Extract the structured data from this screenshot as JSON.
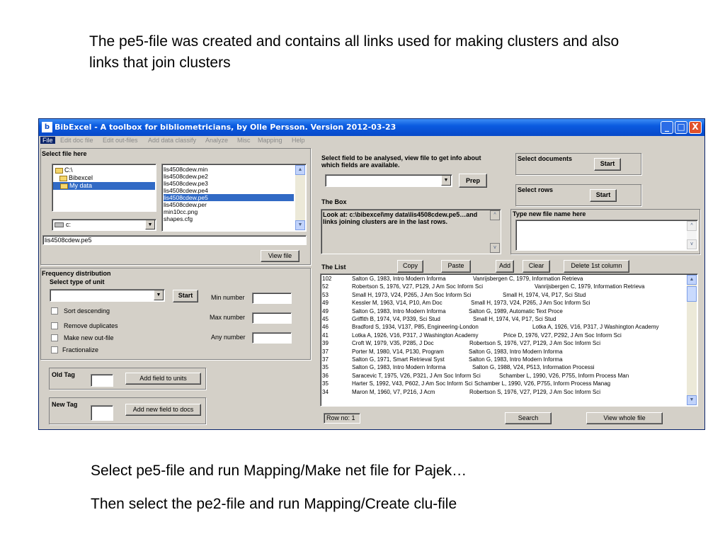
{
  "slide": {
    "intro": "The pe5-file was created and contains all links used for making clusters and also links that join clusters",
    "step1": "Select pe5-file and run Mapping/Make net file for Pajek…",
    "step2": "Then select the pe2-file and run Mapping/Create clu-file"
  },
  "window": {
    "title": "BibExcel -  A toolbox for bibliometricians, by Olle Persson. Version 2012-03-23",
    "icon_letter": "b",
    "minimize": "_",
    "maximize": "□",
    "close": "X"
  },
  "menu": [
    "File",
    "Edit doc file",
    "Edit out-files",
    "Add data classify",
    "Analyze",
    "Misc",
    "Mapping",
    "Help"
  ],
  "select_file": {
    "heading": "Select file here",
    "folders": [
      {
        "label": "C:\\",
        "selected": false
      },
      {
        "label": "Bibexcel",
        "selected": false
      },
      {
        "label": "My data",
        "selected": true
      }
    ],
    "files": [
      {
        "label": "lis4508cdew.min",
        "selected": false
      },
      {
        "label": "lis4508cdew.pe2",
        "selected": false
      },
      {
        "label": "lis4508cdew.pe3",
        "selected": false
      },
      {
        "label": "lis4508cdew.pe4",
        "selected": false
      },
      {
        "label": "lis4508cdew.pe5",
        "selected": true
      },
      {
        "label": "lis4508cdew.per",
        "selected": false
      },
      {
        "label": "min10cc.png",
        "selected": false
      },
      {
        "label": "shapes.cfg",
        "selected": false
      }
    ],
    "drive": "c:",
    "path_value": "lis4508cdew.pe5",
    "view_file": "View file"
  },
  "frequency": {
    "heading": "Frequency distribution",
    "unit_label": "Select type of unit",
    "start": "Start",
    "min_number": "Min number",
    "max_number": "Max number",
    "any_number": "Any number",
    "options": [
      "Sort descending",
      "Remove duplicates",
      "Make new out-file",
      "Fractionalize"
    ]
  },
  "old_tag": {
    "label": "Old Tag",
    "button": "Add field to units"
  },
  "new_tag": {
    "label": "New Tag",
    "button": "Add new field to docs"
  },
  "analyse": {
    "text": "Select field to be analysed, view file to get info about which fields are available.",
    "prep": "Prep"
  },
  "documents": {
    "label": "Select documents",
    "start": "Start"
  },
  "rows": {
    "label": "Select rows",
    "start": "Start"
  },
  "the_box": {
    "title": "The Box",
    "text": "Look at: c:\\bibexcel\\my data\\lis4508cdew.pe5…and links joining clusters are in the last rows."
  },
  "new_file": {
    "label": "Type new file name here"
  },
  "the_list": {
    "title": "The List",
    "buttons": {
      "copy": "Copy",
      "paste": "Paste",
      "add": "Add",
      "clear": "Clear",
      "delete": "Delete 1st column"
    },
    "rows": [
      {
        "count": "102",
        "a": "Salton G, 1983, Intro Modern Informa",
        "b": "Vanrijsbergen C, 1979, Information Retrieva"
      },
      {
        "count": "52",
        "a": "Robertson S, 1976, V27, P129, J Am Soc Inform Sci",
        "b": "Vanrijsbergen C, 1979, Information Retrieva"
      },
      {
        "count": "53",
        "a": "Small H, 1973, V24, P265, J Am Soc Inform Sci",
        "b": "Small H, 1974, V4, P17, Sci Stud"
      },
      {
        "count": "49",
        "a": "Kessler M, 1963, V14, P10, Am Doc",
        "b": "Small H, 1973, V24, P265, J Am Soc Inform Sci"
      },
      {
        "count": "49",
        "a": "Salton G, 1983, Intro Modern Informa",
        "b": "Salton G, 1989, Automatic Text Proce"
      },
      {
        "count": "45",
        "a": "Griffith B, 1974, V4, P339, Sci Stud",
        "b": "Small H, 1974, V4, P17, Sci Stud"
      },
      {
        "count": "46",
        "a": "Bradford S, 1934, V137, P85, Engineering-London",
        "b": "Lotka A, 1926, V16, P317, J Washington Academy"
      },
      {
        "count": "41",
        "a": "Lotka A, 1926, V16, P317, J Washington Academy",
        "b": "Price D, 1976, V27, P292, J Am Soc Inform Sci"
      },
      {
        "count": "39",
        "a": "Croft W, 1979, V35, P285, J Doc",
        "b": "Robertson S, 1976, V27, P129, J Am Soc Inform Sci"
      },
      {
        "count": "37",
        "a": "Porter M, 1980, V14, P130, Program",
        "b": "Salton G, 1983, Intro Modern Informa"
      },
      {
        "count": "37",
        "a": "Salton G, 1971, Smart Retrieval Syst",
        "b": "Salton G, 1983, Intro Modern Informa"
      },
      {
        "count": "35",
        "a": "Salton G, 1983, Intro Modern Informa",
        "b": "Salton G, 1988, V24, P513, Information Processi"
      },
      {
        "count": "36",
        "a": "Saracevic T, 1975, V26, P321, J Am Soc Inform Sci",
        "b": "Schamber L, 1990, V26, P755, Inform Process Man"
      },
      {
        "count": "35",
        "a": "Harter S, 1992, V43, P602, J Am Soc Inform Sci",
        "b": "Schamber L, 1990, V26, P755, Inform Process Manag"
      },
      {
        "count": "34",
        "a": "Maron M, 1960, V7, P216, J Acm",
        "b": "Robertson S, 1976, V27, P129, J Am Soc Inform Sci"
      }
    ],
    "row_no": "Row no: 1",
    "search": "Search",
    "view_whole": "View whole file"
  }
}
